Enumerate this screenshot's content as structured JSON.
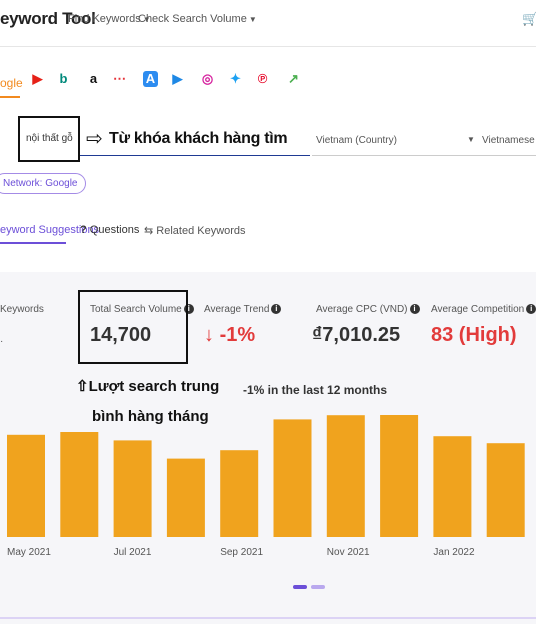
{
  "header": {
    "logo": "eyword Tool",
    "nav": [
      {
        "label": "Find Keywords"
      },
      {
        "label": "Check Search Volume"
      }
    ]
  },
  "sources": {
    "active_label": "ogle",
    "icons": [
      {
        "name": "youtube-icon",
        "glyph": "▶",
        "color": "#e62117",
        "bg": "#ffffff"
      },
      {
        "name": "bing-icon",
        "glyph": "b",
        "color": "#00897b",
        "bg": "#ffffff"
      },
      {
        "name": "amazon-icon",
        "glyph": "a",
        "color": "#111111",
        "bg": "#ffffff"
      },
      {
        "name": "ebay-icon",
        "glyph": "⋯",
        "color": "#e53238",
        "bg": "#ffffff"
      },
      {
        "name": "app-store-icon",
        "glyph": "A",
        "color": "#ffffff",
        "bg": "#2d8cf0"
      },
      {
        "name": "play-store-icon",
        "glyph": "▶",
        "color": "#1e88e5",
        "bg": "#ffffff"
      },
      {
        "name": "instagram-icon",
        "glyph": "◎",
        "color": "#d6249f",
        "bg": "#ffffff"
      },
      {
        "name": "twitter-icon",
        "glyph": "✦",
        "color": "#1da1f2",
        "bg": "#ffffff"
      },
      {
        "name": "pinterest-icon",
        "glyph": "℗",
        "color": "#e60023",
        "bg": "#ffffff"
      },
      {
        "name": "trends-icon",
        "glyph": "↗",
        "color": "#4caf50",
        "bg": "#ffffff"
      }
    ]
  },
  "search": {
    "value": "nội thất gỗ",
    "annotation": "Từ khóa khách hàng tìm",
    "country": "Vietnam (Country)",
    "language": "Vietnamese -"
  },
  "network_chip": "Network: Google",
  "result_tabs": {
    "suggestions": "eyword Suggestions",
    "questions": "Questions",
    "related": "Related Keywords"
  },
  "stats": {
    "keywords_label": "Keywords",
    "volume_label": "Total Search Volume",
    "volume_value": "14,700",
    "trend_label": "Average Trend",
    "trend_value": "-1%",
    "cpc_label": "Average CPC (VND)",
    "cpc_value": "₫7,010.25",
    "competition_label": "Average Competition",
    "competition_value": "83 (High)"
  },
  "annotation_volume_1": "Lượt search trung",
  "annotation_volume_2": "bình hàng tháng",
  "trend_note": "-1% in the last 12 months",
  "chart_data": {
    "type": "bar",
    "color": "#f0a31e",
    "x_tick_labels": [
      "May 2021",
      "Jul 2021",
      "Sep 2021",
      "Nov 2021",
      "Jan 2022"
    ],
    "values": [
      0.73,
      0.75,
      0.69,
      0.56,
      0.62,
      0.84,
      0.87,
      0.89,
      0.72,
      0.67
    ],
    "value_scale": "relative bar height (0-1), no y-axis shown"
  }
}
